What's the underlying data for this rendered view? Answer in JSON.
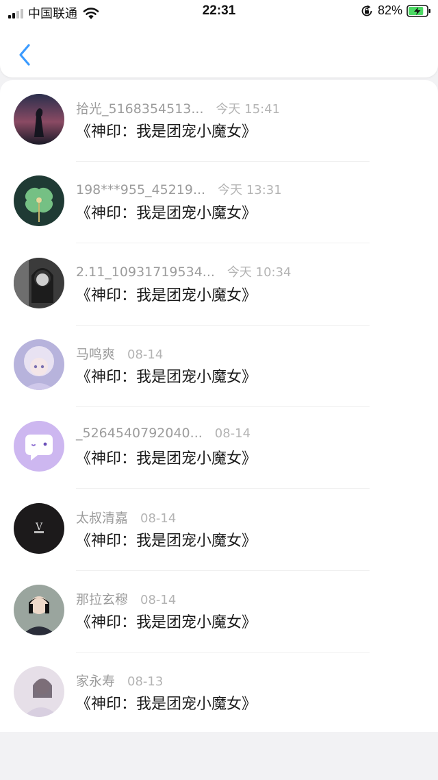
{
  "status_bar": {
    "carrier": "中国联通",
    "time": "22:31",
    "battery": "82%",
    "battery_level": 0.82,
    "signal_icon": "signal-bars-icon",
    "wifi_icon": "wifi-icon",
    "rotation_lock_icon": "rotation-lock-icon",
    "battery_icon": "battery-charging-icon"
  },
  "nav": {
    "back_icon": "chevron-left-icon",
    "accent": "#3b9bff"
  },
  "items": [
    {
      "user": "拾光_5168354513...",
      "time": "今天 15:41",
      "title": "《神印：我是团宠小魔女》"
    },
    {
      "user": "198***955_45219...",
      "time": "今天 13:31",
      "title": "《神印：我是团宠小魔女》"
    },
    {
      "user": "2.11_10931719534...",
      "time": "今天 10:34",
      "title": "《神印：我是团宠小魔女》"
    },
    {
      "user": "马鸣爽",
      "time": "08-14",
      "title": "《神印：我是团宠小魔女》"
    },
    {
      "user": "_5264540792040...",
      "time": "08-14",
      "title": "《神印：我是团宠小魔女》"
    },
    {
      "user": "太叔清嘉",
      "time": "08-14",
      "title": "《神印：我是团宠小魔女》"
    },
    {
      "user": "那拉玄穆",
      "time": "08-14",
      "title": "《神印：我是团宠小魔女》"
    },
    {
      "user": "家永寿",
      "time": "08-13",
      "title": "《神印：我是团宠小魔女》"
    }
  ]
}
